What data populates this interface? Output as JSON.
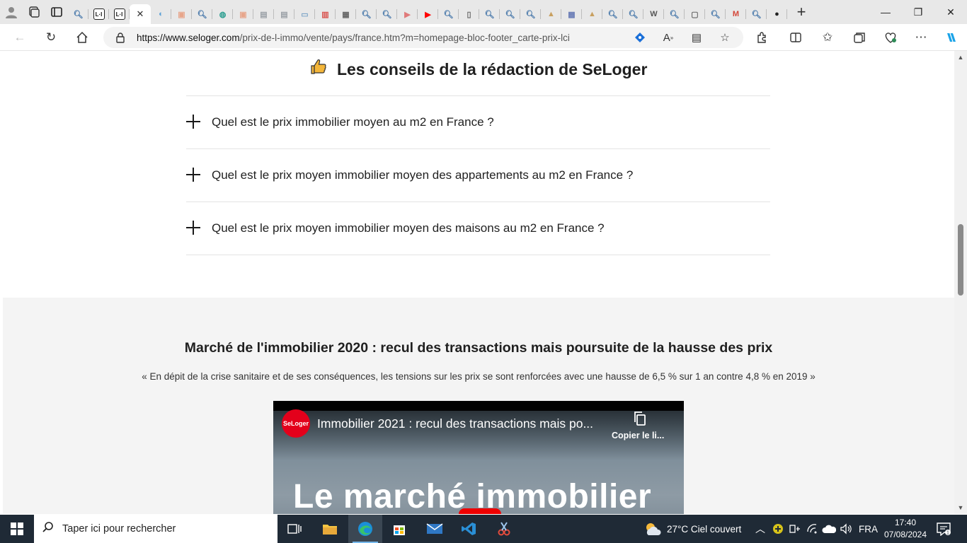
{
  "browser": {
    "address": {
      "url_domain": "https://www.seloger.com",
      "url_path": "/prix-de-l-immo/vente/pays/france.htm?m=homepage-bloc-footer_carte-prix-lci"
    },
    "tabs": [
      {
        "icon": "search-icon",
        "color": "#3a6ea5",
        "glyph": "🔍︎"
      },
      {
        "icon": "li-icon",
        "color": "#ffffff",
        "glyph": "L·I"
      },
      {
        "icon": "li-icon",
        "color": "#ffffff",
        "glyph": "L·I"
      },
      {
        "icon": "close-icon",
        "color": "#333333",
        "glyph": "✕"
      },
      {
        "icon": "edge-icon",
        "color": "#5aa0d6",
        "glyph": "◐"
      },
      {
        "icon": "image-icon",
        "color": "#e7a58a",
        "glyph": "▣"
      },
      {
        "icon": "search-icon",
        "color": "#3a6ea5",
        "glyph": "🔍︎"
      },
      {
        "icon": "globe-icon",
        "color": "#2a9d8f",
        "glyph": "◍"
      },
      {
        "icon": "image-icon",
        "color": "#e7a58a",
        "glyph": "▣"
      },
      {
        "icon": "doc-icon",
        "color": "#9aa0a6",
        "glyph": "▤"
      },
      {
        "icon": "doc-icon",
        "color": "#9aa0a6",
        "glyph": "▤"
      },
      {
        "icon": "screen-icon",
        "color": "#7fa6c8",
        "glyph": "▭"
      },
      {
        "icon": "pdf-icon",
        "color": "#d9534f",
        "glyph": "▥"
      },
      {
        "icon": "calendar-icon",
        "color": "#666666",
        "glyph": "▦"
      },
      {
        "icon": "search-icon",
        "color": "#3a6ea5",
        "glyph": "🔍︎"
      },
      {
        "icon": "search-icon",
        "color": "#3a6ea5",
        "glyph": "🔍︎"
      },
      {
        "icon": "youtube-icon",
        "color": "#e07a7a",
        "glyph": "▶"
      },
      {
        "icon": "youtube-icon",
        "color": "#ff0000",
        "glyph": "▶"
      },
      {
        "icon": "search-icon",
        "color": "#3a6ea5",
        "glyph": "🔍︎"
      },
      {
        "icon": "doc-icon",
        "color": "#666666",
        "glyph": "▯"
      },
      {
        "icon": "search-icon",
        "color": "#3a6ea5",
        "glyph": "🔍︎"
      },
      {
        "icon": "search-icon",
        "color": "#3a6ea5",
        "glyph": "🔍︎"
      },
      {
        "icon": "search-icon",
        "color": "#3a6ea5",
        "glyph": "🔍︎"
      },
      {
        "icon": "pma-icon",
        "color": "#c8a060",
        "glyph": "▲"
      },
      {
        "icon": "php-icon",
        "color": "#6c7eb7",
        "glyph": "▩"
      },
      {
        "icon": "pma-icon",
        "color": "#c8a060",
        "glyph": "▲"
      },
      {
        "icon": "search-icon",
        "color": "#3a6ea5",
        "glyph": "🔍︎"
      },
      {
        "icon": "search-icon",
        "color": "#3a6ea5",
        "glyph": "🔍︎"
      },
      {
        "icon": "wikipedia-icon",
        "color": "#555555",
        "glyph": "W"
      },
      {
        "icon": "search-icon",
        "color": "#3a6ea5",
        "glyph": "🔍︎"
      },
      {
        "icon": "app-icon",
        "color": "#666666",
        "glyph": "▢"
      },
      {
        "icon": "search-icon",
        "color": "#3a6ea5",
        "glyph": "🔍︎"
      },
      {
        "icon": "gmail-icon",
        "color": "#d44638",
        "glyph": "M"
      },
      {
        "icon": "search-icon",
        "color": "#3a6ea5",
        "glyph": "🔍︎"
      },
      {
        "icon": "github-icon",
        "color": "#222222",
        "glyph": "●"
      }
    ]
  },
  "page": {
    "advice_title": "Les conseils de la rédaction de SeLoger",
    "faq": [
      {
        "question": "Quel est le prix immobilier moyen au m2 en France ?"
      },
      {
        "question": "Quel est le prix moyen immobilier moyen des appartements au m2 en France ?"
      },
      {
        "question": "Quel est le prix moyen immobilier moyen des maisons au m2 en France ?"
      }
    ],
    "market": {
      "title": "Marché de l'immobilier 2020 : recul des transactions mais poursuite de la hausse des prix",
      "quote": "« En dépit de la crise sanitaire et de ses conséquences, les tensions sur les prix se sont renforcées avec une hausse de 6,5 % sur 1 an contre 4,8 % en 2019 »",
      "video": {
        "channel_logo_text": "SeLoger",
        "title": "Immobilier 2021 : recul des transactions mais po...",
        "copy_label": "Copier le li...",
        "overlay_text": "Le marché immobilier"
      }
    }
  },
  "taskbar": {
    "search_placeholder": "Taper ici pour rechercher",
    "weather": "27°C  Ciel couvert",
    "language": "FRA",
    "time": "17:40",
    "date": "07/08/2024"
  },
  "colors": {
    "brand_red": "#e3001b",
    "taskbar_bg": "#1f2a36",
    "market_bg": "#f4f4f4"
  }
}
